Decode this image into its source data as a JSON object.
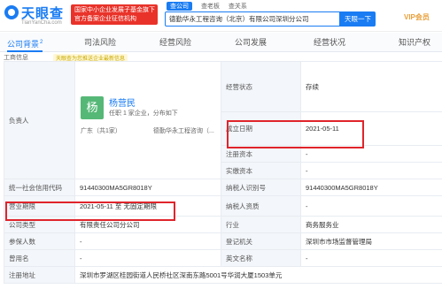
{
  "header": {
    "logo_text": "天眼查",
    "logo_sub": "TianYanCha.com",
    "promo_line1": "国家中小企业发展子基金旗下",
    "promo_line2": "官方备案企业征信机构",
    "search_tabs": [
      "查公司",
      "查老板",
      "查关系"
    ],
    "search_value": "德勤华永工程咨询（北京）有限公司深圳分公司",
    "search_button": "天眼一下",
    "vip_label": "VIP会员"
  },
  "nav": {
    "tabs": [
      {
        "label": "公司背景",
        "count": "2"
      },
      {
        "label": "司法风险",
        "count": ""
      },
      {
        "label": "经营风险",
        "count": ""
      },
      {
        "label": "公司发展",
        "count": ""
      },
      {
        "label": "经营状况",
        "count": ""
      },
      {
        "label": "知识产权",
        "count": ""
      }
    ]
  },
  "section": {
    "title": "工商信息",
    "badge": "天眼查为您推送企业最新信息"
  },
  "owner": {
    "label": "负责人",
    "avatar_char": "杨",
    "name": "杨营民",
    "role": "任职 1 家企业，分布如下",
    "region": "广东（共1家）",
    "company": "德勤华永工程咨询（..."
  },
  "fields": {
    "status_label": "经营状态",
    "status_value": "存续",
    "founded_label": "成立日期",
    "founded_value": "2021-05-11",
    "reg_capital_label": "注册资本",
    "reg_capital_value": "-",
    "paid_capital_label": "实缴资本",
    "paid_capital_value": "-",
    "credit_code_label": "统一社会信用代码",
    "credit_code_value": "91440300MA5GR8018Y",
    "taxpayer_id_label": "纳税人识别号",
    "taxpayer_id_value": "91440300MA5GR8018Y",
    "term_label": "营业期限",
    "term_value": "2021-05-11 至 无固定期限",
    "taxpayer_qual_label": "纳税人资质",
    "taxpayer_qual_value": "-",
    "company_type_label": "公司类型",
    "company_type_value": "有限责任公司分公司",
    "industry_label": "行业",
    "industry_value": "商务服务业",
    "insured_label": "参保人数",
    "insured_value": "-",
    "authority_label": "登记机关",
    "authority_value": "深圳市市场监督管理局",
    "former_name_label": "曾用名",
    "former_name_value": "-",
    "english_name_label": "英文名称",
    "english_name_value": "-",
    "address_label": "注册地址",
    "address_value": "深圳市罗湖区桂园街道人民桥社区深南东路5001号华润大厦1503单元"
  },
  "colors": {
    "brand": "#1a7cf3",
    "promo": "#e9332a",
    "highlight": "#e0242b",
    "avatar": "#56b877",
    "label_bg": "#f3f6fa"
  }
}
